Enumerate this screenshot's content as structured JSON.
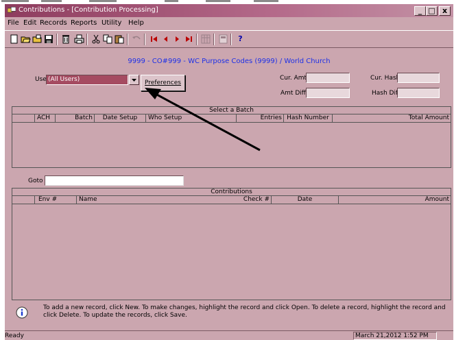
{
  "window": {
    "title": "Contributions - [Contribution Processing]",
    "minimize_glyph": "_",
    "maximize_glyph": "□",
    "close_glyph": "x"
  },
  "menu": [
    "File",
    "Edit",
    "Records",
    "Reports",
    "Utility",
    "Help"
  ],
  "toolbar": {
    "icons": [
      "new-icon",
      "open-icon",
      "open-folder-icon",
      "save-icon",
      "delete-icon",
      "print-icon",
      "cut-icon",
      "copy-icon",
      "paste-icon",
      "undo-icon",
      "first-record-icon",
      "prev-record-icon",
      "next-record-icon",
      "last-record-icon",
      "grid-icon",
      "calculator-icon",
      "help-icon"
    ],
    "help_glyph": "?"
  },
  "header": {
    "org_line": "9999 - CO#999 - WC Purpose Codes (9999) / World Church"
  },
  "filters": {
    "user_label": "User",
    "user_value": "(All Users)",
    "preferences_label": "Preferences",
    "cur_amt_label": "Cur. Amt",
    "cur_hash_label": "Cur. Hash",
    "amt_diff_label": "Amt Diff",
    "hash_diff_label": "Hash Diff"
  },
  "batch_grid": {
    "caption": "Select a Batch",
    "columns": [
      "",
      "ACH",
      "Batch",
      "Date Setup",
      "Who Setup",
      "Entries",
      "Hash Number",
      "Total Amount"
    ]
  },
  "goto": {
    "label": "Goto",
    "value": ""
  },
  "contrib_grid": {
    "caption": "Contributions",
    "columns": [
      "",
      "Env #",
      "Name",
      "Check #",
      "Date",
      "Amount"
    ]
  },
  "info": {
    "text": "To add a new record, click New.  To make changes, highlight the record and click Open.  To delete a record, highlight the record and click Delete. To update the records, click Save."
  },
  "status": {
    "left": "Ready",
    "datetime": "March 21,2012 1:52 PM"
  },
  "colors": {
    "window_bg": "#cba6af",
    "title_start": "#8e3c5e",
    "org_text": "#1c2fe8",
    "user_select_bg": "#a54b61"
  }
}
